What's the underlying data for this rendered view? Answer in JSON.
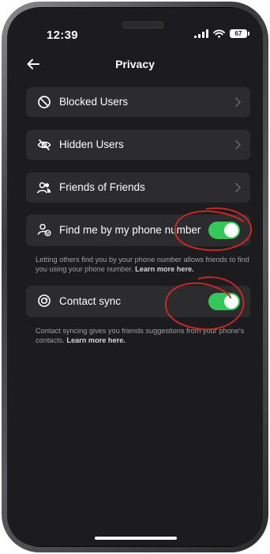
{
  "status_bar": {
    "time": "12:39",
    "battery": "67"
  },
  "header": {
    "title": "Privacy"
  },
  "settings": {
    "blocked_users": {
      "label": "Blocked Users",
      "icon": "block-icon"
    },
    "hidden_users": {
      "label": "Hidden Users",
      "icon": "eye-slash-icon"
    },
    "friends_of_friends": {
      "label": "Friends of Friends",
      "icon": "people-icon"
    },
    "find_by_phone": {
      "label": "Find me by my phone number",
      "icon": "user-check-icon",
      "enabled": true,
      "helper_text": "Letting others find you by your phone number allows friends to find you using your phone number.",
      "learn_more": "Learn more here."
    },
    "contact_sync": {
      "label": "Contact sync",
      "icon": "sync-icon",
      "enabled": true,
      "helper_text": "Contact syncing gives you friends suggestions from your phone's contacts.",
      "learn_more": "Learn more here."
    }
  },
  "colors": {
    "background": "#1c1c1e",
    "row_background": "#2c2c2e",
    "toggle_on": "#34c759",
    "annotation": "#c62828"
  }
}
